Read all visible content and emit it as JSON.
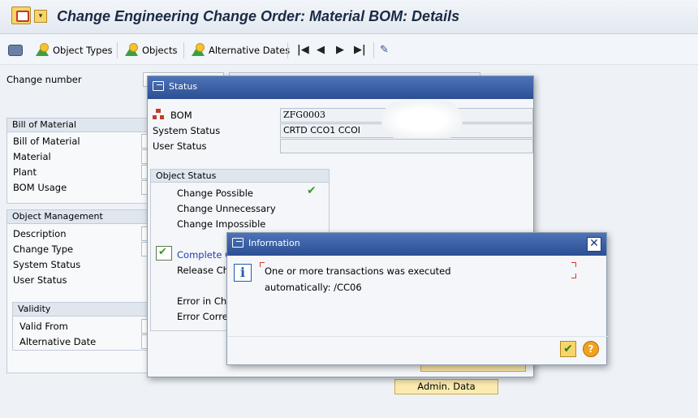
{
  "window": {
    "title": "Change Engineering Change Order: Material BOM: Details"
  },
  "toolbar": {
    "object_types_label": "Object Types",
    "objects_label": "Objects",
    "alternative_dates_label": "Alternative Dates"
  },
  "header": {
    "change_number_label": "Change number"
  },
  "bom_group": {
    "title": "Bill of Material",
    "bill_of_material_label": "Bill of Material",
    "material_label": "Material",
    "plant_label": "Plant",
    "bom_usage_label": "BOM Usage"
  },
  "object_mgmt": {
    "title": "Object Management",
    "description_label": "Description",
    "change_type_label": "Change Type",
    "system_status_label": "System Status",
    "user_status_label": "User Status"
  },
  "validity": {
    "title": "Validity",
    "valid_from_label": "Valid From",
    "alternative_date_label": "Alternative Date"
  },
  "status_dialog": {
    "title": "Status",
    "bom_label": "BOM",
    "bom_value": "ZFG0003",
    "system_status_label": "System Status",
    "system_status_value": "CRTD CCO1 CCOI",
    "user_status_label": "User Status",
    "user_status_value": "",
    "object_status_title": "Object Status",
    "change_possible": "Change Possible",
    "change_unnecessary": "Change Unnecessary",
    "change_impossible": "Change Impossible",
    "complete_change": "Complete Ch",
    "release_change": "Release Cha",
    "error_in_change": "Error in Cha",
    "error_correct": "Error Correct"
  },
  "info_dialog": {
    "title": "Information",
    "line1": "One or more transactions was executed",
    "line2": "automatically: /CC06"
  },
  "admin_button": {
    "label": "Admin. Data"
  }
}
